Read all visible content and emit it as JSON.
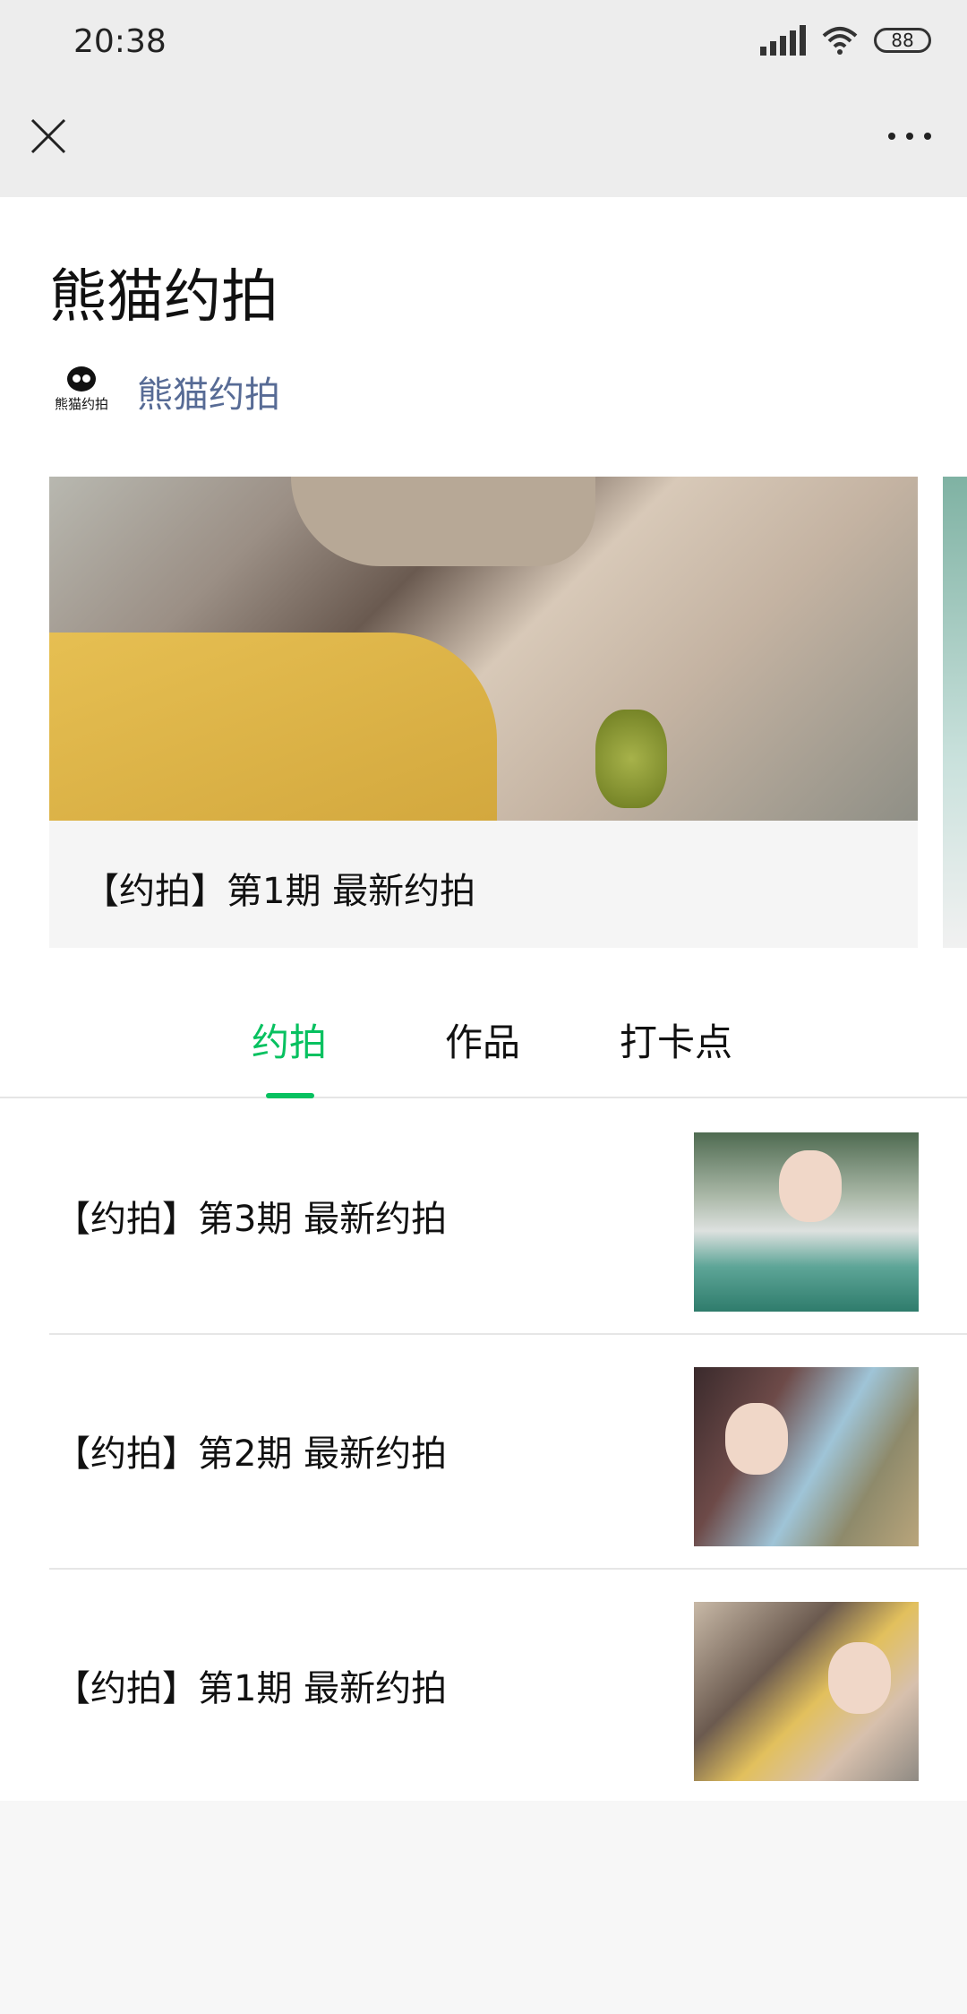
{
  "status_bar": {
    "time": "20:38",
    "battery": "88"
  },
  "article": {
    "title": "熊猫约拍",
    "account_name": "熊猫约拍",
    "logo_text": "熊猫约拍"
  },
  "carousel": {
    "items": [
      {
        "caption": "【约拍】第1期 最新约拍"
      }
    ]
  },
  "tabs": [
    {
      "label": "约拍",
      "active": true
    },
    {
      "label": "作品",
      "active": false
    },
    {
      "label": "打卡点",
      "active": false
    }
  ],
  "list": [
    {
      "title": "【约拍】第3期 最新约拍"
    },
    {
      "title": "【约拍】第2期 最新约拍"
    },
    {
      "title": "【约拍】第1期 最新约拍"
    }
  ],
  "colors": {
    "accent": "#07c160",
    "account_link": "#576b95",
    "bar_bg": "#ededed"
  }
}
